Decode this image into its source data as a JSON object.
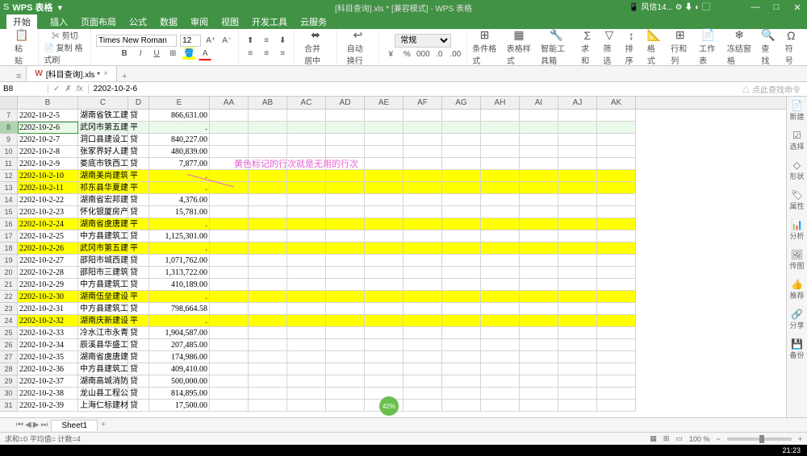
{
  "app": {
    "name": "WPS 表格",
    "doc_title": "[科目查询].xls * [兼容模式] - WPS 表格",
    "wx_label": "风信14..."
  },
  "menu": {
    "items": [
      "开始",
      "插入",
      "页面布局",
      "公式",
      "数据",
      "审阅",
      "视图",
      "开发工具",
      "云服务"
    ],
    "active_index": 0
  },
  "ribbon": {
    "paste": "粘贴",
    "cut": "剪切",
    "copy": "复制 格式刷",
    "font_name": "Times New Roman",
    "font_size": "12",
    "merge": "合并居中",
    "wrap": "自动换行",
    "number_format": "常规",
    "cond_fmt": "条件格式",
    "table_style": "表格样式",
    "smart_tool": "智能工具箱",
    "sum": "求和",
    "filter": "筛选",
    "sort": "排序",
    "format": "格式",
    "row_col": "行和列",
    "worksheet": "工作表",
    "freeze": "冻结窗格",
    "find": "查找",
    "symbol": "符号"
  },
  "doc_tab": {
    "label": "[科目查询].xls *"
  },
  "formula_bar": {
    "cell_ref": "B8",
    "value": "2202-10-2-6",
    "search_hint": "△ 点此查找命令"
  },
  "columns": [
    "B",
    "C",
    "D",
    "E",
    "AA",
    "AB",
    "AC",
    "AD",
    "AE",
    "AF",
    "AG",
    "AH",
    "AI",
    "AJ",
    "AK"
  ],
  "rows": [
    {
      "n": 7,
      "b": "2202-10-2-5",
      "c": "湖南省铁工建",
      "d": "贷",
      "e": "866,631.00",
      "hl": false
    },
    {
      "n": 8,
      "b": "2202-10-2-6",
      "c": "武冈市第五建",
      "d": "平",
      "e": ".",
      "hl": true,
      "sel": true
    },
    {
      "n": 9,
      "b": "2202-10-2-7",
      "c": "洞口县建设工",
      "d": "贷",
      "e": "840,227.00",
      "hl": false
    },
    {
      "n": 10,
      "b": "2202-10-2-8",
      "c": "张家界好人建",
      "d": "贷",
      "e": "480,839.00",
      "hl": false
    },
    {
      "n": 11,
      "b": "2202-10-2-9",
      "c": "娄底市铁西工",
      "d": "贷",
      "e": "7,877.00",
      "hl": false
    },
    {
      "n": 12,
      "b": "2202-10-2-10",
      "c": "湖南美尚建筑",
      "d": "平",
      "e": ".",
      "hl": true
    },
    {
      "n": 13,
      "b": "2202-10-2-11",
      "c": "祁东县华夏建",
      "d": "平",
      "e": ".",
      "hl": true
    },
    {
      "n": 14,
      "b": "2202-10-2-22",
      "c": "湖南省宏邦建",
      "d": "贷",
      "e": "4,376.00",
      "hl": false
    },
    {
      "n": 15,
      "b": "2202-10-2-23",
      "c": "怀化银厦房产",
      "d": "贷",
      "e": "15,781.00",
      "hl": false
    },
    {
      "n": 16,
      "b": "2202-10-2-24",
      "c": "湖南省虞唐建",
      "d": "平",
      "e": ".",
      "hl": true
    },
    {
      "n": 17,
      "b": "2202-10-2-25",
      "c": "中方县建筑工",
      "d": "贷",
      "e": "1,125,301.00",
      "hl": false
    },
    {
      "n": 18,
      "b": "2202-10-2-26",
      "c": "武冈市第五建",
      "d": "平",
      "e": ".",
      "hl": true
    },
    {
      "n": 19,
      "b": "2202-10-2-27",
      "c": "邵阳市城西建",
      "d": "贷",
      "e": "1,071,762.00",
      "hl": false
    },
    {
      "n": 20,
      "b": "2202-10-2-28",
      "c": "邵阳市三建筑",
      "d": "贷",
      "e": "1,313,722.00",
      "hl": false
    },
    {
      "n": 21,
      "b": "2202-10-2-29",
      "c": "中方县建筑工",
      "d": "贷",
      "e": "410,189.00",
      "hl": false
    },
    {
      "n": 22,
      "b": "2202-10-2-30",
      "c": "湖南伍垒建设",
      "d": "平",
      "e": ".",
      "hl": true
    },
    {
      "n": 23,
      "b": "2202-10-2-31",
      "c": "中方县建筑工",
      "d": "贷",
      "e": "798,664.58",
      "hl": false
    },
    {
      "n": 24,
      "b": "2202-10-2-32",
      "c": "湖南庆新建设",
      "d": "平",
      "e": ".",
      "hl": true
    },
    {
      "n": 25,
      "b": "2202-10-2-33",
      "c": "冷水江市永青",
      "d": "贷",
      "e": "1,904,587.00",
      "hl": false
    },
    {
      "n": 26,
      "b": "2202-10-2-34",
      "c": "辰溪县华盛工",
      "d": "贷",
      "e": "207,485.00",
      "hl": false
    },
    {
      "n": 27,
      "b": "2202-10-2-35",
      "c": "湖南省虞唐建",
      "d": "贷",
      "e": "174,986.00",
      "hl": false
    },
    {
      "n": 28,
      "b": "2202-10-2-36",
      "c": "中方县建筑工",
      "d": "贷",
      "e": "409,410.00",
      "hl": false
    },
    {
      "n": 29,
      "b": "2202-10-2-37",
      "c": "湖南高城消防",
      "d": "贷",
      "e": "500,000.00",
      "hl": false
    },
    {
      "n": 30,
      "b": "2202-10-2-38",
      "c": "龙山县工程公",
      "d": "贷",
      "e": "814,895.00",
      "hl": false
    },
    {
      "n": 31,
      "b": "2202-10-2-39",
      "c": "上海仁标建材",
      "d": "贷",
      "e": "17,500.00",
      "hl": false
    }
  ],
  "annotation": "黄色标记的行次就是无用的行次",
  "sheet_tab": "Sheet1",
  "status": {
    "left": "求和=0  平均值=  计数=4",
    "zoom": "100 %"
  },
  "side_panel": [
    "新建",
    "选择",
    "形状",
    "属性",
    "分析",
    "传图",
    "推荐",
    "分享",
    "备份"
  ],
  "badge_text": "42%",
  "clock": "21:23"
}
